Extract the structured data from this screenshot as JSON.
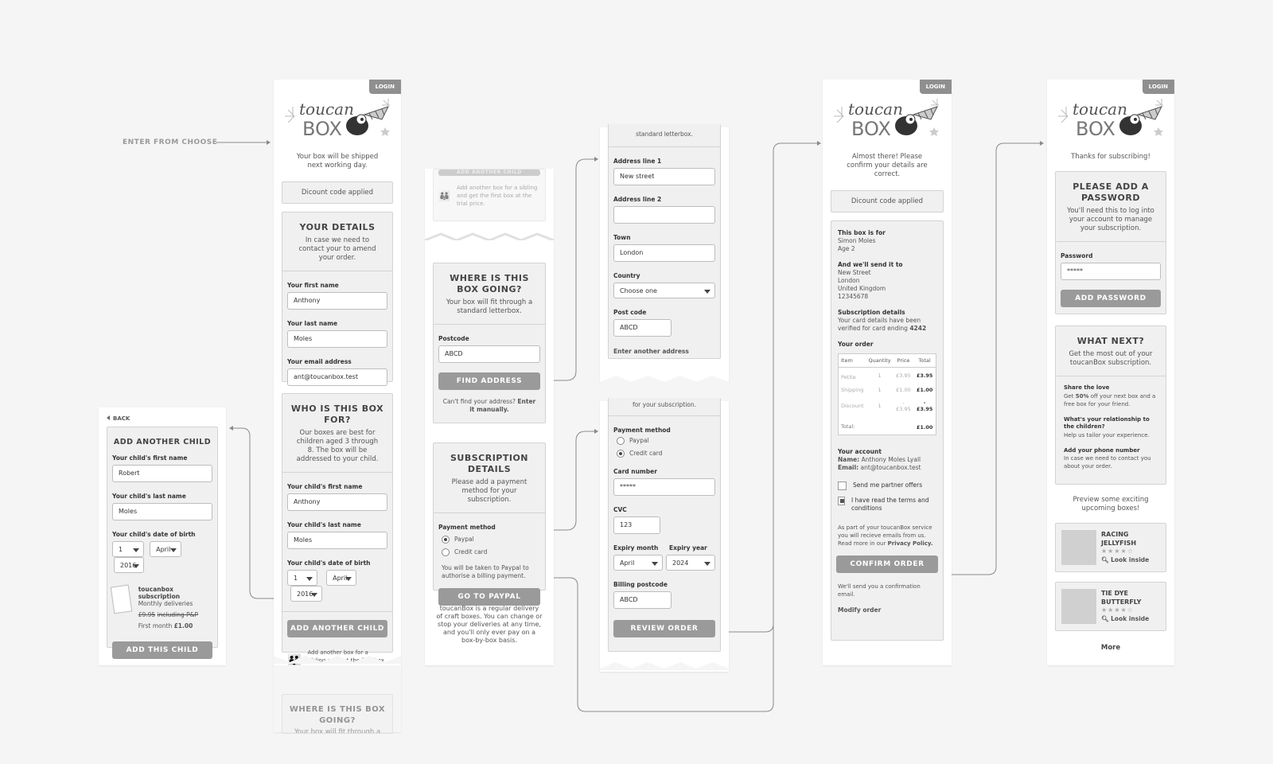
{
  "flow": {
    "enter_label": "ENTER FROM CHOOSE"
  },
  "brand": {
    "login": "LOGIN",
    "logo_line1": "toucan",
    "logo_line2": "BOX"
  },
  "screen1": {
    "intro": "Your box will be shipped next working day.",
    "discount": "Dicount code applied",
    "details_title": "YOUR DETAILS",
    "details_desc": "In case we need to contact your to amend your order.",
    "first_name_label": "Your first name",
    "first_name": "Anthony",
    "last_name_label": "Your last name",
    "last_name": "Moles",
    "email_label": "Your email address",
    "email": "ant@toucanbox.test",
    "who_title": "WHO IS THIS BOX FOR?",
    "who_desc": "Our boxes are best for children aged 3 through 8. The box will be addressed to your child.",
    "child_first_label": "Your child's first name",
    "child_first": "Anthony",
    "child_last_label": "Your child's last name",
    "child_last": "Moles",
    "dob_label": "Your child's date of birth",
    "dob_day": "1",
    "dob_month": "April",
    "dob_year": "2016",
    "add_child_btn": "ADD ANOTHER CHILD",
    "sibling_note": "Add another box for a sibling and get the first box at the trial price.",
    "next_title": "WHERE IS THIS BOX GOING?",
    "next_desc": "Your box will fit through a"
  },
  "child": {
    "back": "BACK",
    "title": "ADD ANOTHER CHILD",
    "first_label": "Your child's first name",
    "first": "Robert",
    "last_label": "Your child's last name",
    "last": "Moles",
    "dob_label": "Your child's date of birth",
    "dob_day": "1",
    "dob_month": "April",
    "dob_year": "2016",
    "sub_title": "toucanbox subscription",
    "sub_freq": "Monthly deliveries",
    "sub_price_old": "£9.95",
    "sub_price_note": "including P&P",
    "sub_first_label": "First month",
    "sub_first_price": "£1.00",
    "add_btn": "ADD THIS CHILD"
  },
  "screen2": {
    "faded_btn": "ADD ANOTHER CHILD",
    "faded_note": "Add another box for a sibling and get the first box at the trial price.",
    "where_title": "WHERE IS THIS BOX GOING?",
    "where_desc": "Your box will fit through a standard letterbox.",
    "postcode_label": "Postcode",
    "postcode": "ABCD",
    "find_btn": "FIND ADDRESS",
    "manual_pre": "Can't find your address?",
    "manual_link": "Enter it manually.",
    "sub_title": "SUBSCRIPTION DETAILS",
    "sub_desc": "Please add a payment method for your subscription.",
    "pay_label": "Payment method",
    "paypal": "Paypal",
    "credit": "Credit card",
    "paypal_note": "You will be taken to Paypal to authorise a billing payment.",
    "paypal_btn": "GO TO PAYPAL",
    "footer": "toucanBox is a regular delivery of craft boxes. You can change or stop your deliveries at any time, and you'll only ever pay on a box-by-box basis."
  },
  "screen3": {
    "top_text": "standard letterbox.",
    "addr1_label": "Address line 1",
    "addr1": "New street",
    "addr2_label": "Address line 2",
    "addr2": "",
    "town_label": "Town",
    "town": "London",
    "country_label": "Country",
    "country": "Choose one",
    "post_label": "Post code",
    "post": "ABCD",
    "another": "Enter another address"
  },
  "screen4": {
    "top_text": "for your subscription.",
    "pay_label": "Payment method",
    "paypal": "Paypal",
    "credit": "Credit card",
    "card_label": "Card number",
    "card": "*****",
    "cvc_label": "CVC",
    "cvc": "123",
    "exp_m_label": "Expiry month",
    "exp_m": "April",
    "exp_y_label": "Expiry year",
    "exp_y": "2024",
    "bill_label": "Billing postcode",
    "bill": "ABCD",
    "review_btn": "REVIEW ORDER"
  },
  "screen5": {
    "intro": "Almost there! Please confirm your details are correct.",
    "discount": "Dicount code applied",
    "for_label": "This box is for",
    "for_name": "Simon Moles",
    "for_age": "Age 2",
    "send_label": "And we'll send it to",
    "addr": [
      "New Street",
      "London",
      "United Kingdom",
      "12345678"
    ],
    "sub_label": "Subscription details",
    "sub_text": "Your card details have been verified for card ending",
    "card_end": "4242",
    "order_label": "Your order",
    "cols": [
      "Item",
      "Quantity",
      "Price",
      "Total"
    ],
    "rows": [
      {
        "item": "Petite",
        "qty": "1",
        "price": "£3.95",
        "total": "£3.95"
      },
      {
        "item": "Shipping",
        "qty": "1",
        "price": "£1.00",
        "total": "£1.00"
      },
      {
        "item": "Discount",
        "qty": "1",
        "price": "-£3.95",
        "total": "-£3.95"
      }
    ],
    "total_label": "Total:",
    "total": "£1.00",
    "acct_label": "Your account",
    "name_key": "Name:",
    "name_val": "Anthony Moles Lyall",
    "email_key": "Email:",
    "email_val": "ant@toucanbox.test",
    "partner": "Send me partner offers",
    "terms": "I have read the terms and conditions",
    "privacy_pre": "As part of your toucanBox service you will recieve emails from us. Read more in our",
    "privacy_link": "Privacy Policy.",
    "confirm_btn": "CONFIRM ORDER",
    "confirm_note": "We'll send you a confirmation email.",
    "modify": "Modify order"
  },
  "screen6": {
    "intro": "Thanks for subscribing!",
    "pw_title": "PLEASE ADD A PASSWORD",
    "pw_desc": "You'll need this to log into your account to manage your subscription.",
    "pw_label": "Password",
    "pw": "*****",
    "pw_btn": "ADD PASSWORD",
    "next_title": "WHAT NEXT?",
    "next_desc": "Get the most out of your toucanBox subscription.",
    "love_title": "Share the love",
    "love_pre": "Get",
    "love_pct": "50%",
    "love_post": "off your next box and a free box for your friend.",
    "rel_title": "What's your relationship to the children?",
    "rel_text": "Help us tailor your experience.",
    "phone_title": "Add your phone number",
    "phone_text": "In case we need to contact you about your order.",
    "preview": "Preview some exciting upcoming boxes!",
    "boxes": [
      {
        "name": "RACING JELLYFISH",
        "look": "Look inside",
        "rating": 4
      },
      {
        "name": "TIE DYE BUTTERFLY",
        "look": "Look inside",
        "rating": 4
      }
    ],
    "more": "More"
  }
}
